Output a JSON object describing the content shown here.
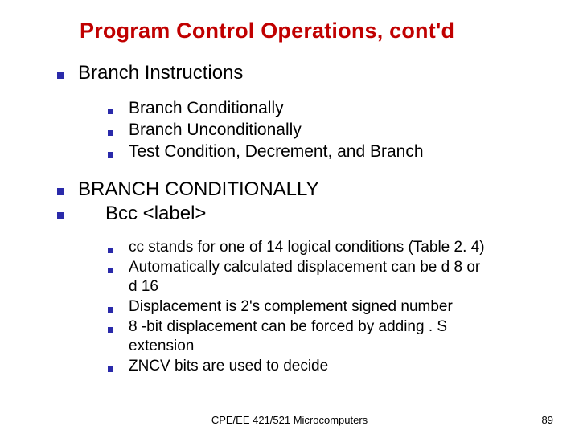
{
  "title": "Program Control Operations, cont'd",
  "h1": "Branch Instructions",
  "sub1": [
    "Branch Conditionally",
    "Branch Unconditionally",
    "Test Condition, Decrement, and Branch"
  ],
  "h2a": "BRANCH CONDITIONALLY",
  "h2b": "Bcc <label>",
  "sub2": [
    "cc stands for one of 14 logical conditions (Table 2. 4)",
    "Automatically calculated displacement can be d 8 or",
    "d 16",
    "Displacement is 2's complement signed number",
    "8 -bit displacement can be forced by adding . S",
    "extension",
    "ZNCV bits are used to decide"
  ],
  "footer_center": "CPE/EE 421/521 Microcomputers",
  "footer_right": "89"
}
